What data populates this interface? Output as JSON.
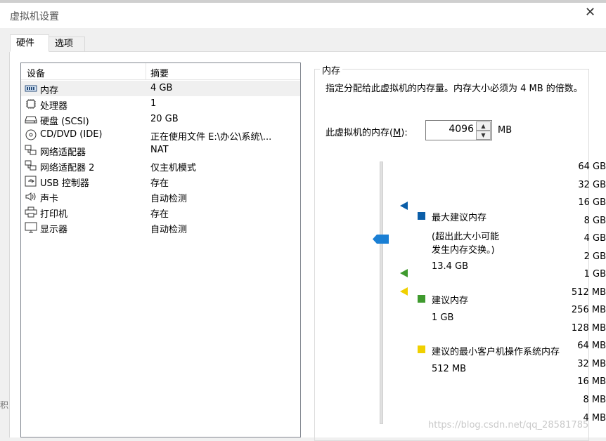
{
  "window": {
    "title": "虚拟机设置"
  },
  "tabs": [
    {
      "label": "硬件",
      "active": true
    },
    {
      "label": "选项",
      "active": false
    }
  ],
  "device_list": {
    "headers": {
      "device": "设备",
      "summary": "摘要"
    },
    "rows": [
      {
        "icon": "memory-icon",
        "name": "内存",
        "summary": "4 GB",
        "selected": true
      },
      {
        "icon": "processor-icon",
        "name": "处理器",
        "summary": "1"
      },
      {
        "icon": "hard-disk-icon",
        "name": "硬盘 (SCSI)",
        "summary": "20 GB"
      },
      {
        "icon": "cd-dvd-icon",
        "name": "CD/DVD (IDE)",
        "summary": "正在使用文件 E:\\办公\\系统\\..."
      },
      {
        "icon": "network-adapter-icon",
        "name": "网络适配器",
        "summary": "NAT"
      },
      {
        "icon": "network-adapter-icon",
        "name": "网络适配器 2",
        "summary": "仅主机模式"
      },
      {
        "icon": "usb-icon",
        "name": "USB 控制器",
        "summary": "存在"
      },
      {
        "icon": "sound-card-icon",
        "name": "声卡",
        "summary": "自动检测"
      },
      {
        "icon": "printer-icon",
        "name": "打印机",
        "summary": "存在"
      },
      {
        "icon": "display-icon",
        "name": "显示器",
        "summary": "自动检测"
      }
    ]
  },
  "memory": {
    "group_title": "内存",
    "description": "指定分配给此虚拟机的内存量。内存大小必须为 4 MB 的倍数。",
    "field_label": "此虚拟机的内存(M):",
    "field_mnemonic": "M",
    "value": "4096",
    "unit": "MB",
    "scale_ticks": [
      "64 GB",
      "32 GB",
      "16 GB",
      "8 GB",
      "4 GB",
      "2 GB",
      "1 GB",
      "512 MB",
      "256 MB",
      "128 MB",
      "64 MB",
      "32 MB",
      "16 MB",
      "8 MB",
      "4 MB"
    ],
    "legend": {
      "max": {
        "title": "最大建议内存",
        "note_line1": "(超出此大小可能",
        "note_line2": "发生内存交换。)",
        "value": "13.4 GB",
        "color": "#0b5ea8"
      },
      "recommended": {
        "title": "建议内存",
        "value": "1 GB",
        "color": "#3f9a2e"
      },
      "min_guest": {
        "title": "建议的最小客户机操作系统内存",
        "value": "512 MB",
        "color": "#f0d000"
      }
    },
    "thumb_color": "#1a7fd4"
  },
  "watermark": "https://blog.csdn.net/qq_28581785",
  "edge_fragment": "积"
}
